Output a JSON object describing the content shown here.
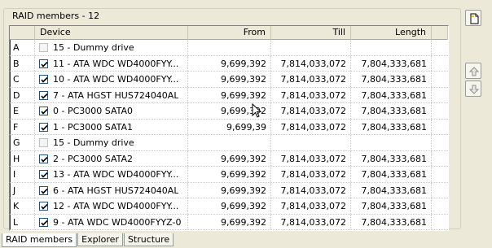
{
  "group": {
    "title": "RAID members - 12"
  },
  "table": {
    "headers": {
      "device": "Device",
      "from": "From",
      "till": "Till",
      "length": "Length"
    },
    "rows": [
      {
        "letter": "A",
        "checked": false,
        "enabled": false,
        "device": "15 - Dummy drive",
        "from": "",
        "till": "",
        "length": ""
      },
      {
        "letter": "B",
        "checked": true,
        "enabled": true,
        "device": "11 - ATA WDC WD4000FYY...",
        "from": "9,699,392",
        "till": "7,814,033,072",
        "length": "7,804,333,681"
      },
      {
        "letter": "C",
        "checked": true,
        "enabled": true,
        "device": "10 - ATA WDC WD4000FYY...",
        "from": "9,699,392",
        "till": "7,814,033,072",
        "length": "7,804,333,681"
      },
      {
        "letter": "D",
        "checked": true,
        "enabled": true,
        "device": "7 - ATA HGST HUS724040AL",
        "from": "9,699,392",
        "till": "7,814,033,072",
        "length": "7,804,333,681"
      },
      {
        "letter": "E",
        "checked": true,
        "enabled": true,
        "device": "0 - PC3000 SATA0",
        "from": "9,699,392",
        "till": "7,814,033,072",
        "length": "7,804,333,681"
      },
      {
        "letter": "F",
        "checked": true,
        "enabled": true,
        "device": "1 - PC3000 SATA1",
        "from": "9,699,39",
        "till": "7,814,033,072",
        "length": "7,804,333,681"
      },
      {
        "letter": "G",
        "checked": false,
        "enabled": false,
        "device": "15 - Dummy drive",
        "from": "",
        "till": "",
        "length": ""
      },
      {
        "letter": "H",
        "checked": true,
        "enabled": true,
        "device": "2 - PC3000 SATA2",
        "from": "9,699,392",
        "till": "7,814,033,072",
        "length": "7,804,333,681"
      },
      {
        "letter": "I",
        "checked": true,
        "enabled": true,
        "device": "13 - ATA WDC WD4000FYY...",
        "from": "9,699,392",
        "till": "7,814,033,072",
        "length": "7,804,333,681"
      },
      {
        "letter": "J",
        "checked": true,
        "enabled": true,
        "device": "6 - ATA HGST HUS724040AL",
        "from": "9,699,392",
        "till": "7,814,033,072",
        "length": "7,804,333,681"
      },
      {
        "letter": "K",
        "checked": true,
        "enabled": true,
        "device": "12 - ATA WDC WD4000FYY...",
        "from": "9,699,392",
        "till": "7,814,033,072",
        "length": "7,804,333,681"
      },
      {
        "letter": "L",
        "checked": true,
        "enabled": true,
        "device": "9 - ATA WDC WD4000FYYZ-0",
        "from": "9,699,392",
        "till": "7,814,033,072",
        "length": "7,804,333,681"
      }
    ]
  },
  "tabs": [
    {
      "label": "RAID members",
      "active": true
    },
    {
      "label": "Explorer",
      "active": false
    },
    {
      "label": "Structure",
      "active": false
    }
  ],
  "side_buttons": {
    "new": {
      "icon": "new-document-icon"
    },
    "up": {
      "icon": "arrow-up-icon"
    },
    "down": {
      "icon": "arrow-down-icon"
    }
  },
  "colors": {
    "window_bg": "#ece9d8",
    "checkbox_border": "#1c5180",
    "check_mark": "#21a121"
  }
}
